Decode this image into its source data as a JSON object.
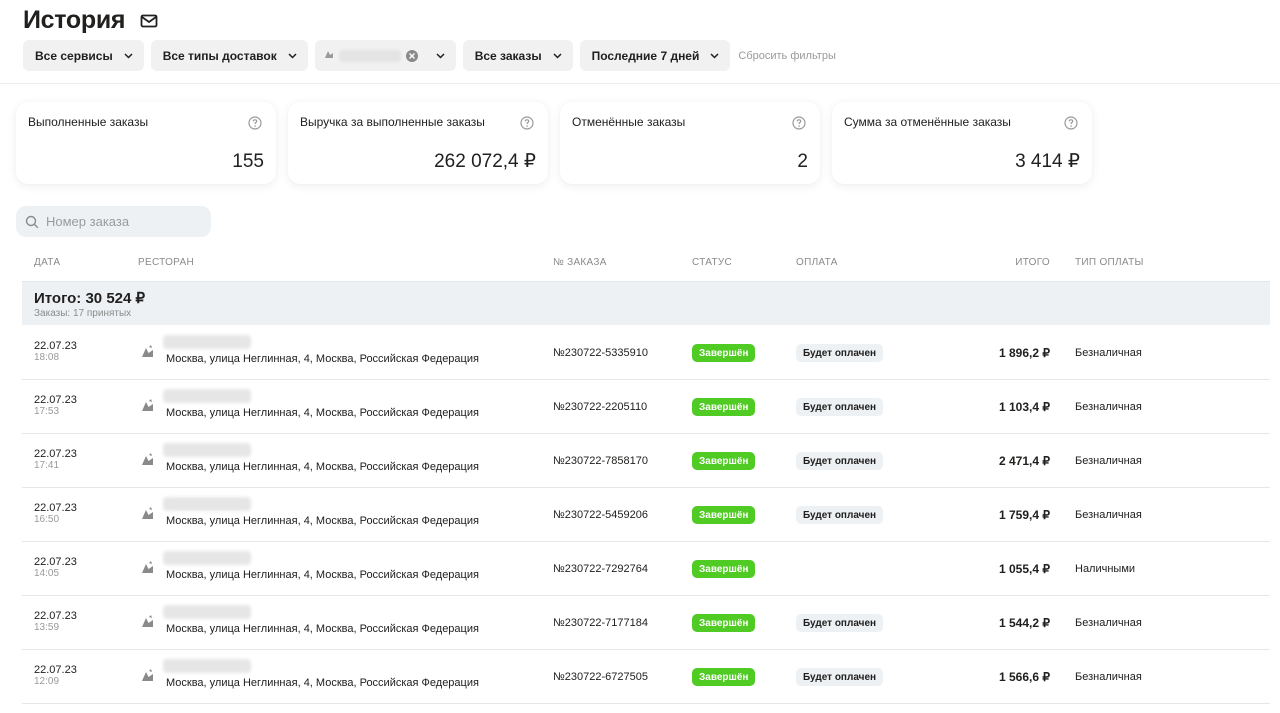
{
  "header": {
    "title": "История",
    "mail_icon": "mail-icon"
  },
  "filters": {
    "services": "Все сервисы",
    "delivery_types": "Все типы доставок",
    "orders": "Все заказы",
    "period": "Последние 7 дней",
    "reset": "Сбросить фильтры"
  },
  "cards": [
    {
      "label": "Выполненные заказы",
      "value": "155"
    },
    {
      "label": "Выручка за выполненные заказы",
      "value": "262 072,4 ₽"
    },
    {
      "label": "Отменённые заказы",
      "value": "2"
    },
    {
      "label": "Сумма за отменённые заказы",
      "value": "3 414 ₽"
    }
  ],
  "search": {
    "placeholder": "Номер заказа"
  },
  "table": {
    "columns": {
      "date": "ДАТА",
      "restaurant": "РЕСТОРАН",
      "order_number": "№ ЗАКАЗА",
      "status": "СТАТУС",
      "payment": "ОПЛАТА",
      "total": "ИТОГО",
      "payment_type": "ТИП ОПЛАТЫ"
    },
    "summary": {
      "title": "Итого: 30 524 ₽",
      "subtitle": "Заказы: 17 принятых"
    },
    "rows": [
      {
        "date": "22.07.23",
        "time": "18:08",
        "address": "Москва, улица Неглинная, 4, Москва, Российская Федерация",
        "number": "№230722-5335910",
        "status": "Завершён",
        "payment": "Будет оплачен",
        "total": "1 896,2 ₽",
        "payment_type": "Безналичная"
      },
      {
        "date": "22.07.23",
        "time": "17:53",
        "address": "Москва, улица Неглинная, 4, Москва, Российская Федерация",
        "number": "№230722-2205110",
        "status": "Завершён",
        "payment": "Будет оплачен",
        "total": "1 103,4 ₽",
        "payment_type": "Безналичная"
      },
      {
        "date": "22.07.23",
        "time": "17:41",
        "address": "Москва, улица Неглинная, 4, Москва, Российская Федерация",
        "number": "№230722-7858170",
        "status": "Завершён",
        "payment": "Будет оплачен",
        "total": "2 471,4 ₽",
        "payment_type": "Безналичная"
      },
      {
        "date": "22.07.23",
        "time": "16:50",
        "address": "Москва, улица Неглинная, 4, Москва, Российская Федерация",
        "number": "№230722-5459206",
        "status": "Завершён",
        "payment": "Будет оплачен",
        "total": "1 759,4 ₽",
        "payment_type": "Безналичная"
      },
      {
        "date": "22.07.23",
        "time": "14:05",
        "address": "Москва, улица Неглинная, 4, Москва, Российская Федерация",
        "number": "№230722-7292764",
        "status": "Завершён",
        "payment": "",
        "total": "1 055,4 ₽",
        "payment_type": "Наличными"
      },
      {
        "date": "22.07.23",
        "time": "13:59",
        "address": "Москва, улица Неглинная, 4, Москва, Российская Федерация",
        "number": "№230722-7177184",
        "status": "Завершён",
        "payment": "Будет оплачен",
        "total": "1 544,2 ₽",
        "payment_type": "Безналичная"
      },
      {
        "date": "22.07.23",
        "time": "12:09",
        "address": "Москва, улица Неглинная, 4, Москва, Российская Федерация",
        "number": "№230722-6727505",
        "status": "Завершён",
        "payment": "Будет оплачен",
        "total": "1 566,6 ₽",
        "payment_type": "Безналичная"
      }
    ]
  },
  "colors": {
    "status_green": "#4fcb23",
    "row_badge_bg": "#eef1f4"
  }
}
